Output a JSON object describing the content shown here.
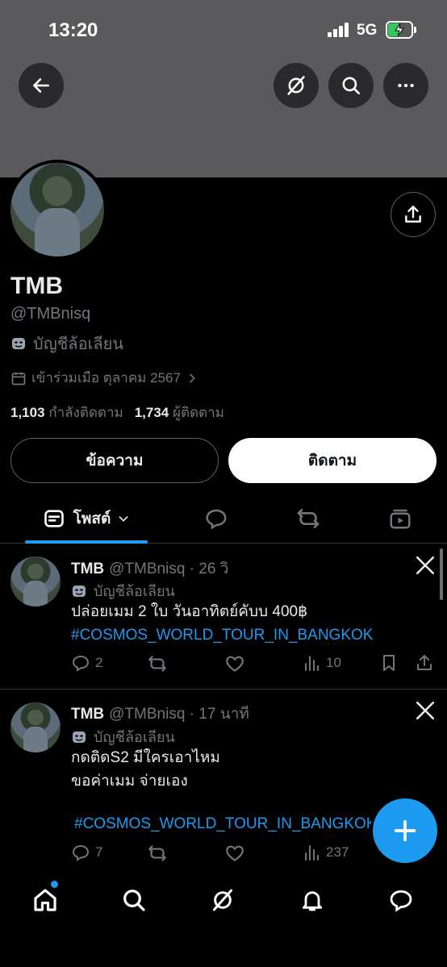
{
  "status_bar": {
    "time": "13:20",
    "network": "5G",
    "battery_level": 0.55
  },
  "header": {
    "back_icon": "arrow-left-icon",
    "grok_icon": "grok-icon",
    "search_icon": "search-icon",
    "more_icon": "more-icon"
  },
  "profile": {
    "display_name": "TMB",
    "handle": "@TMBnisq",
    "parody_label": "บัญชีล้อเลียน",
    "joined": "เข้าร่วมเมือ ตุลาคม 2567",
    "following_count": "1,103",
    "following_label": "กำลังติดตาม",
    "followers_count": "1,734",
    "followers_label": "ผู้ติดตาม",
    "message_label": "ข้อความ",
    "follow_label": "ติดตาม"
  },
  "tabs": [
    {
      "label": "โพสต์",
      "icon": "posts-icon",
      "active": true
    },
    {
      "icon": "replies-icon"
    },
    {
      "icon": "reposts-icon"
    },
    {
      "icon": "media-icon"
    }
  ],
  "posts": [
    {
      "name": "TMB",
      "meta": "@TMBnisq · 26 วิ",
      "parody_label": "บัญชีล้อเลียน",
      "text_lines": [
        "ปล่อยเมม 2 ใบ วันอาทิตย์คับบ 400฿"
      ],
      "hashtag": "#COSMOS_WORLD_TOUR_IN_BANGKOK",
      "replies": "2",
      "views": "10"
    },
    {
      "name": "TMB",
      "meta": "@TMBnisq · 17 นาที",
      "parody_label": "บัญชีล้อเลียน",
      "text_lines": [
        "กดติดS2 มีใครเอาไหม",
        "ขอค่าเมม จ่ายเอง"
      ],
      "hashtag": "#COSMOS_WORLD_TOUR_IN_BANGKOK",
      "replies": "7",
      "views": "237"
    }
  ],
  "bottom_nav": [
    "home-icon",
    "search-icon",
    "grok-icon",
    "notifications-icon",
    "messages-icon"
  ],
  "colors": {
    "accent": "#1d9bf0",
    "secondary_text": "#71767b",
    "divider": "#2f3336",
    "banner": "#5a5a5c"
  }
}
